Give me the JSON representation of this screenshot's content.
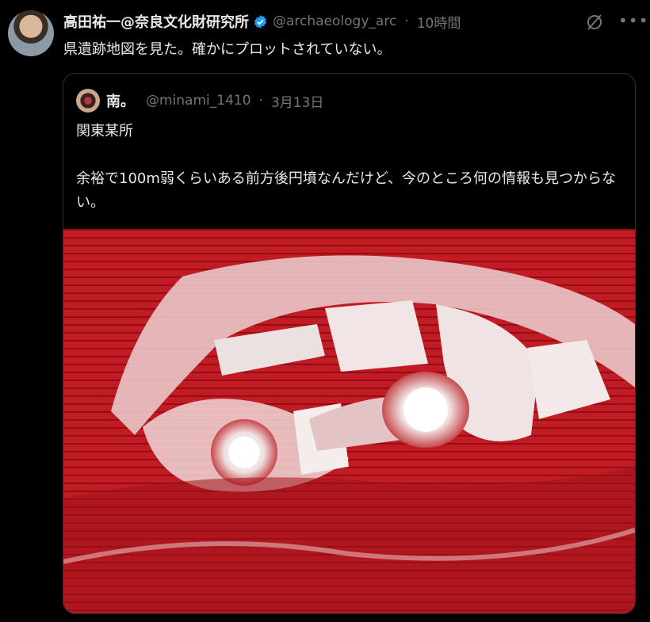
{
  "tweet": {
    "author_name": "高田祐一@奈良文化財研究所",
    "handle": "@archaeology_arc",
    "separator": "·",
    "time": "10時間",
    "text": "県遺跡地図を見た。確かにプロットされていない。"
  },
  "quote": {
    "author_name": "南。",
    "handle": "@minami_1410",
    "separator": "·",
    "date": "3月13日",
    "lines": [
      "関東某所",
      "余裕で100m弱くらいある前方後円墳なんだけど、今のところ何の情報も見つからない。"
    ]
  },
  "icons": {
    "verified": "verified-badge-icon",
    "grok": "grok-icon",
    "more": "more-icon"
  },
  "colors": {
    "background": "#000000",
    "text": "#e7e9ea",
    "muted": "#71767b",
    "verified": "#1d9bf0",
    "map_red": "#b5161e"
  }
}
